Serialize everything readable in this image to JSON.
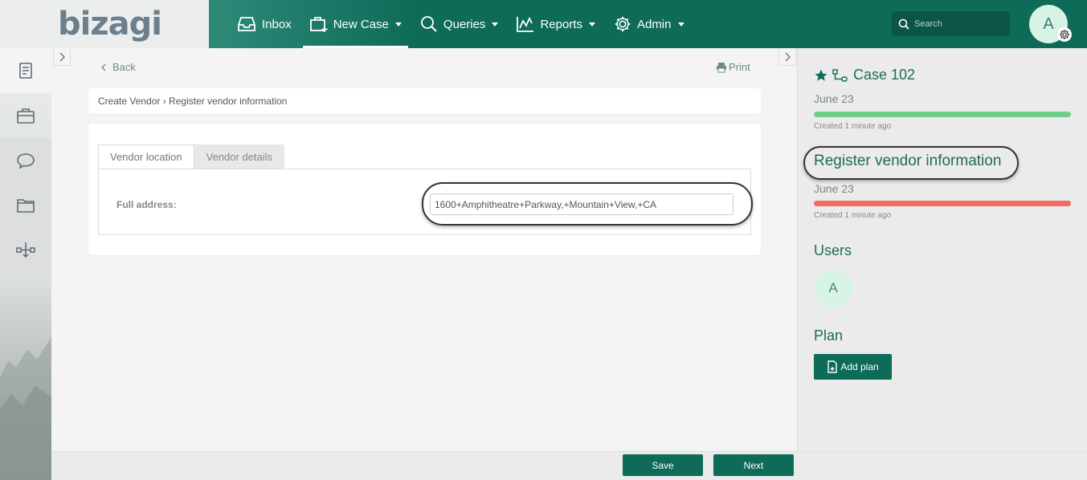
{
  "app": {
    "logo": "bizagi"
  },
  "nav": {
    "inbox": "Inbox",
    "new_case": "New Case",
    "queries": "Queries",
    "reports": "Reports",
    "admin": "Admin"
  },
  "search": {
    "placeholder": "Search"
  },
  "user": {
    "initial": "A"
  },
  "main": {
    "back_label": "Back",
    "print_label": "Print",
    "breadcrumb": "Create Vendor › Register vendor information",
    "tabs": [
      {
        "label": "Vendor location",
        "active": true
      },
      {
        "label": "Vendor details",
        "active": false
      }
    ],
    "field": {
      "label": "Full address:",
      "value": "1600+Amphitheatre+Parkway,+Mountain+View,+CA"
    }
  },
  "footer": {
    "save_label": "Save",
    "next_label": "Next"
  },
  "case_panel": {
    "case_title": "Case 102",
    "case_date": "June 23",
    "case_created": "Created 1 minute ago",
    "case_bar_color": "#6fcf8a",
    "task_title": "Register vendor information",
    "task_date": "June 23",
    "task_created": "Created 1 minute ago",
    "task_bar_color": "#f06b62",
    "users_heading": "Users",
    "user_initial": "A",
    "plan_heading": "Plan",
    "add_plan_label": "Add plan"
  },
  "colors": {
    "brand": "#0d6b58",
    "accent_text": "#1f6b5d"
  }
}
